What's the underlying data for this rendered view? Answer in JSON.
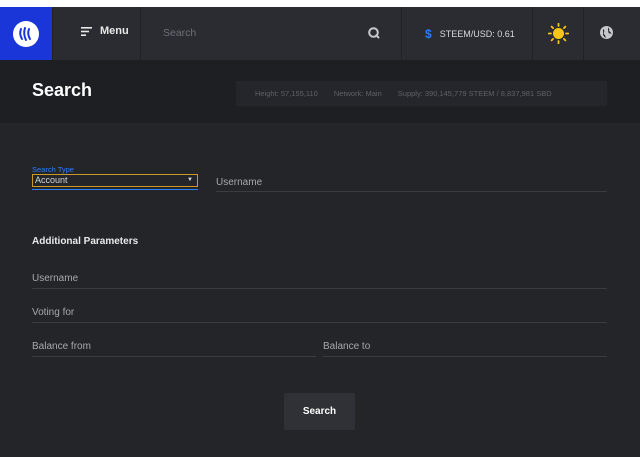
{
  "topbar": {
    "menu_label": "Menu",
    "search_placeholder": "Search",
    "price_label": "STEEM/USD: 0.61",
    "currency_symbol": "$"
  },
  "header": {
    "title": "Search",
    "stats": {
      "height": "Height: 57,155,110",
      "network": "Network: Main",
      "supply": "Supply: 390,145,779 STEEM / 8,837,981 SBD"
    }
  },
  "form": {
    "search_type_label": "Search Type",
    "search_type_value": "Account",
    "username_main": "Username",
    "additional_title": "Additional Parameters",
    "username": "Username",
    "voting_for": "Voting for",
    "balance_from": "Balance from",
    "balance_to": "Balance to",
    "submit_label": "Search"
  },
  "colors": {
    "accent": "#2f7cf6",
    "brand": "#1a35d8",
    "focus": "#c99a27",
    "sun": "#f6c518"
  },
  "icons": [
    "steem-logo-icon",
    "menu-icon",
    "search-icon",
    "dollar-icon",
    "sun-icon",
    "globe-icon",
    "chevron-down-icon"
  ]
}
